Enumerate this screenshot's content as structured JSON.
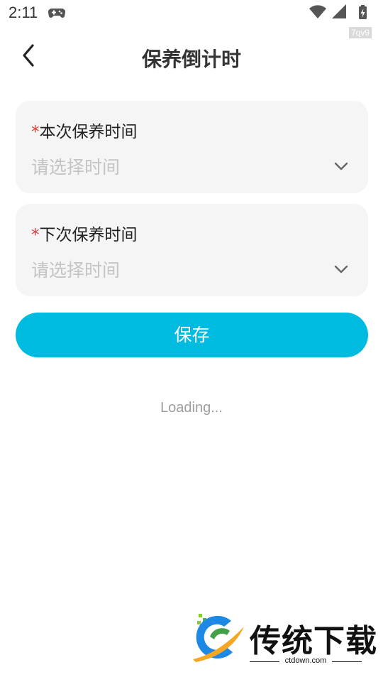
{
  "status_bar": {
    "time": "2:11",
    "icons": [
      "game-controller-icon",
      "wifi-icon",
      "signal-icon",
      "battery-charging-icon"
    ],
    "tag": "7qv9"
  },
  "header": {
    "back_icon": "chevron-left-icon",
    "title": "保养倒计时"
  },
  "form": {
    "fields": [
      {
        "required_mark": "*",
        "label": "本次保养时间",
        "placeholder": "请选择时间",
        "icon": "chevron-down-icon"
      },
      {
        "required_mark": "*",
        "label": "下次保养时间",
        "placeholder": "请选择时间",
        "icon": "chevron-down-icon"
      }
    ],
    "save_label": "保存"
  },
  "loading_text": "Loading...",
  "watermark": {
    "name": "传统下载",
    "url": "ctdown.com"
  },
  "colors": {
    "accent": "#00bbe0",
    "required": "#e53935",
    "card_bg": "#f5f5f5",
    "placeholder": "#c4c4c4"
  }
}
